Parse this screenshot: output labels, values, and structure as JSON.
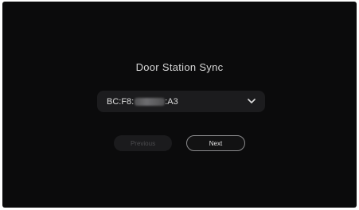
{
  "page": {
    "title": "Door Station Sync"
  },
  "device_select": {
    "value_prefix": "BC:F8:",
    "value_suffix": ":A3",
    "masked": true
  },
  "buttons": {
    "previous_label": "Previous",
    "next_label": "Next"
  },
  "icons": {
    "dropdown": "chevron-down-icon"
  },
  "colors": {
    "background": "#0b0b0c",
    "field": "#1c1c1e",
    "text": "#d6d6d6",
    "disabled_text": "#4c4c4f",
    "next_border": "#8a8a8c"
  }
}
